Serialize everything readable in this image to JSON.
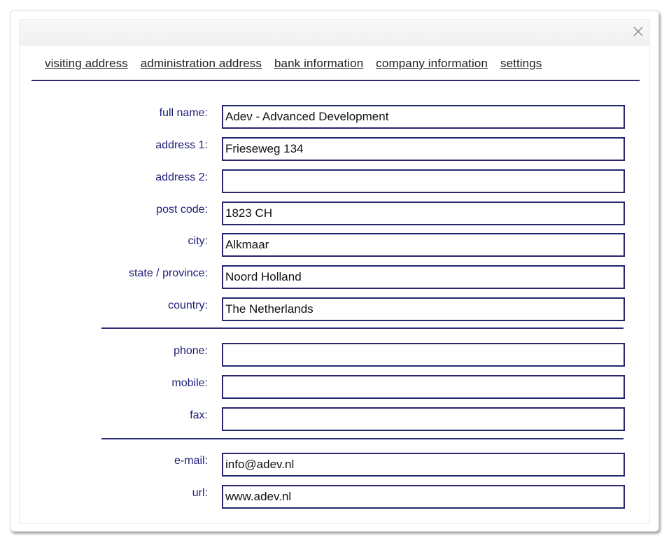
{
  "dialog": {
    "close_icon": "close-icon"
  },
  "tabs": [
    {
      "label": "visiting address"
    },
    {
      "label": "administration address"
    },
    {
      "label": "bank information"
    },
    {
      "label": "company information"
    },
    {
      "label": "settings"
    }
  ],
  "address_fields": [
    {
      "label": "full name:",
      "value": "Adev - Advanced Development"
    },
    {
      "label": "address 1:",
      "value": "Frieseweg 134"
    },
    {
      "label": "address 2:",
      "value": ""
    },
    {
      "label": "post code:",
      "value": "1823 CH"
    },
    {
      "label": "city:",
      "value": "Alkmaar"
    },
    {
      "label": "state / province:",
      "value": "Noord Holland"
    },
    {
      "label": "country:",
      "value": "The Netherlands"
    }
  ],
  "phone_fields": [
    {
      "label": "phone:",
      "value": ""
    },
    {
      "label": "mobile:",
      "value": ""
    },
    {
      "label": "fax:",
      "value": ""
    }
  ],
  "web_fields": [
    {
      "label": "e-mail:",
      "value": "info@adev.nl"
    },
    {
      "label": "url:",
      "value": "www.adev.nl"
    }
  ],
  "colors": {
    "accent": "#2b2b7a",
    "label": "#1e1e7a",
    "input_border": "#26266e"
  }
}
